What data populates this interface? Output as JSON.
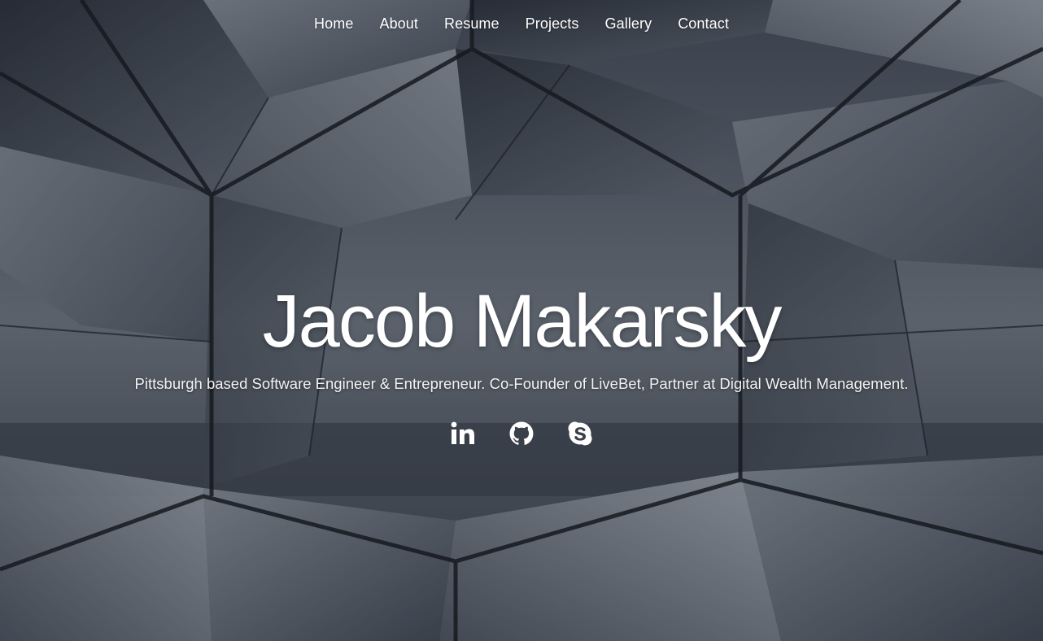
{
  "nav": {
    "items": [
      {
        "label": "Home"
      },
      {
        "label": "About"
      },
      {
        "label": "Resume"
      },
      {
        "label": "Projects"
      },
      {
        "label": "Gallery"
      },
      {
        "label": "Contact"
      }
    ]
  },
  "banner": {
    "name": "Jacob Makarsky",
    "tagline": "Pittsburgh based Software Engineer & Entrepreneur. Co-Founder of LiveBet, Partner at Digital Wealth Management."
  },
  "social": {
    "icons": [
      "linkedin-icon",
      "github-icon",
      "skype-icon"
    ]
  },
  "colors": {
    "text": "#ffffff",
    "overlay": "#0a0e16"
  }
}
